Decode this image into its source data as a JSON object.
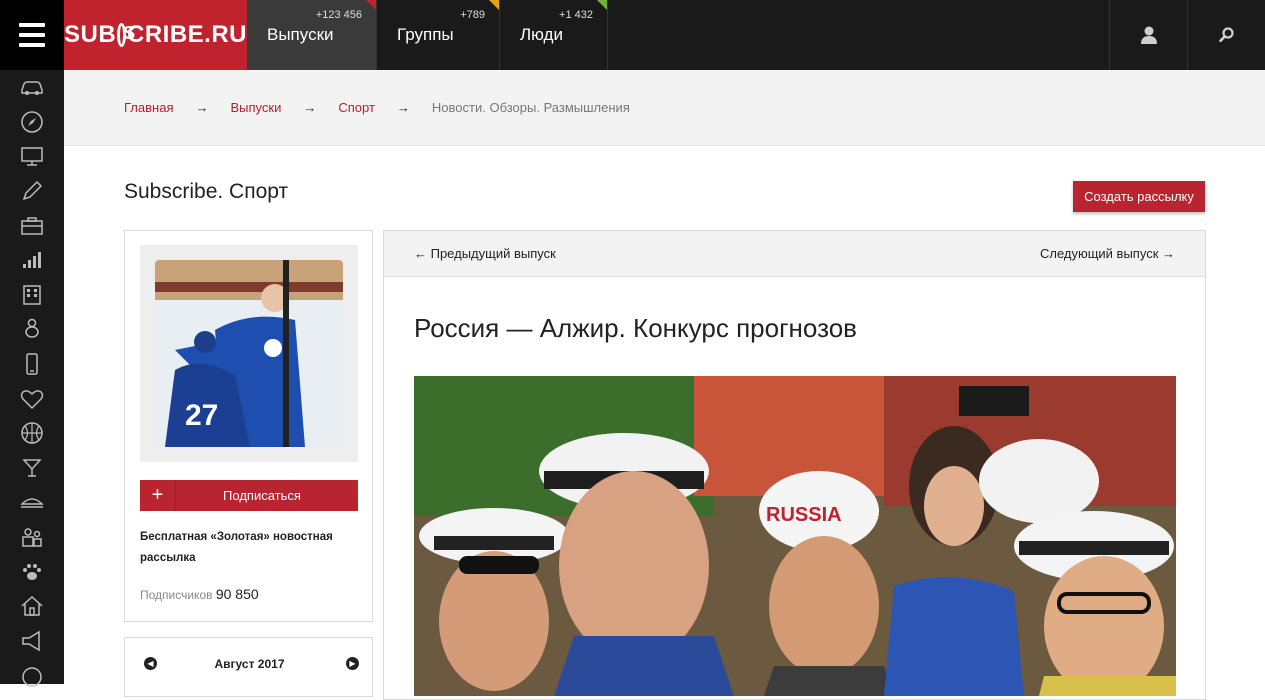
{
  "header": {
    "logo_text_1": "SUB",
    "logo_text_2": "CRIBE.RU",
    "tabs": [
      {
        "label": "Выпуски",
        "count": "+123 456"
      },
      {
        "label": "Группы",
        "count": "+789"
      },
      {
        "label": "Люди",
        "count": "+1 432"
      }
    ],
    "user_icon": "user-icon",
    "search_icon": "search-icon"
  },
  "sidebar": {
    "icons": [
      "car-icon",
      "compass-icon",
      "monitor-icon",
      "pen-icon",
      "briefcase-icon",
      "chart-bars-icon",
      "building-icon",
      "baby-icon",
      "phone-icon",
      "heart-icon",
      "basketball-icon",
      "cocktail-icon",
      "food-icon",
      "people-icon",
      "paw-icon",
      "house-icon",
      "megaphone-icon",
      "circle-icon"
    ]
  },
  "breadcrumb": {
    "items": [
      "Главная",
      "Выпуски",
      "Спорт"
    ],
    "separator": "→",
    "current": "Новости. Обзоры. Размышления"
  },
  "page": {
    "title": "Subscribe. Спорт",
    "create_button": "Создать рассылку"
  },
  "left_card": {
    "subscribe_plus": "+",
    "subscribe_label": "Подписаться",
    "description": "Бесплатная «Золотая» новостная рассылка",
    "subscribers_label": "Подписчиков",
    "subscribers_count": "90 850"
  },
  "calendar": {
    "prev": "◀",
    "month": "Август 2017",
    "next": "▶"
  },
  "article": {
    "prev_label": "← Предыдущий выпуск",
    "next_label": "Следующий выпуск →",
    "title": "Россия — Алжир. Конкурс прогнозов"
  },
  "colors": {
    "accent": "#b8242f",
    "topbar": "#1a1a1a",
    "groups_corner": "#e3a21a",
    "people_corner": "#6cb33f"
  }
}
